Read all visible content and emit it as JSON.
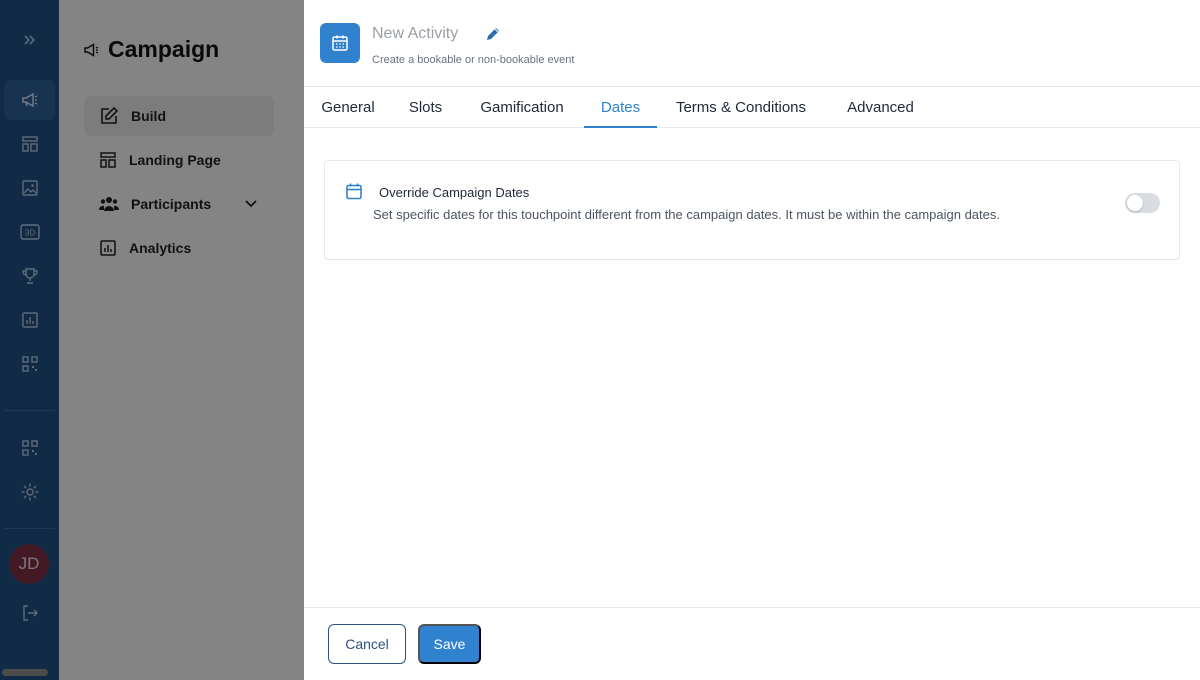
{
  "rail": {
    "items": [
      {
        "icon": "expand-icon"
      },
      {
        "icon": "megaphone-icon",
        "active": true
      },
      {
        "icon": "layout-icon"
      },
      {
        "icon": "image-icon"
      },
      {
        "icon": "3d-icon",
        "label": "3D"
      },
      {
        "icon": "trophy-icon"
      },
      {
        "icon": "chart-icon"
      },
      {
        "icon": "qr-icon"
      },
      {
        "icon": "qr-icon"
      },
      {
        "icon": "gear-icon"
      }
    ],
    "avatar_initials": "JD",
    "logout_icon": "logout-icon"
  },
  "side": {
    "title": "Campaign",
    "items": [
      {
        "label": "Build",
        "icon": "edit-icon",
        "active": true
      },
      {
        "label": "Landing Page",
        "icon": "layout-icon"
      },
      {
        "label": "Participants",
        "icon": "users-icon",
        "expandable": true
      },
      {
        "label": "Analytics",
        "icon": "chart-icon"
      }
    ]
  },
  "drawer": {
    "title_placeholder": "New Activity",
    "subtitle": "Create a bookable or non-bookable event",
    "tabs": [
      {
        "label": "General"
      },
      {
        "label": "Slots"
      },
      {
        "label": "Gamification"
      },
      {
        "label": "Dates",
        "active": true
      },
      {
        "label": "Terms & Conditions"
      },
      {
        "label": "Advanced"
      }
    ],
    "override": {
      "title": "Override Campaign Dates",
      "description": "Set specific dates for this touchpoint different from the campaign dates. It must be within the campaign dates.",
      "enabled": false
    },
    "cancel_label": "Cancel",
    "save_label": "Save"
  },
  "colors": {
    "rail_bg": "#1f4f80",
    "accent": "#3182ce",
    "avatar_bg": "#7a2f44"
  }
}
